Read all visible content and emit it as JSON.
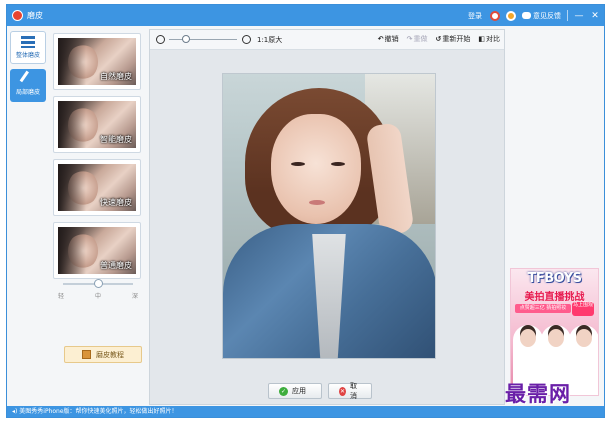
{
  "window": {
    "title": "磨皮",
    "login_label": "登录",
    "feedback_label": "意见反馈",
    "minimize_glyph": "—",
    "close_glyph": "✕"
  },
  "side_tabs": [
    {
      "label": "整体磨皮"
    },
    {
      "label": "局部磨皮"
    }
  ],
  "filters": [
    {
      "label": "自然磨皮"
    },
    {
      "label": "智能磨皮"
    },
    {
      "label": "快速磨皮"
    },
    {
      "label": "普通磨皮"
    }
  ],
  "strength_slider": {
    "labels": [
      "轻",
      "中",
      "深"
    ],
    "value": 0.5
  },
  "tutorial_label": "磨皮教程",
  "toolbar": {
    "zoom_value": 0.25,
    "zoom_label": "1:1原大",
    "undo_label": "撤销",
    "redo_label": "重做",
    "restart_label": "重新开始",
    "compare_label": "对比"
  },
  "actions": {
    "apply_label": "应用",
    "cancel_label": "取消"
  },
  "ad": {
    "title": "TFBOYS",
    "subtitle": "美拍直播挑战",
    "line": "点赞超三亿 猜拍照妆",
    "cta": "马上围观"
  },
  "status_text": "美图秀秀iPhone版：帮你快速美化照片，轻松做出好照片！",
  "watermark": "最需网",
  "colors": {
    "accent": "#3d95e2",
    "ad_pink": "#f4b7cd",
    "watermark": "#6a1fa8"
  }
}
